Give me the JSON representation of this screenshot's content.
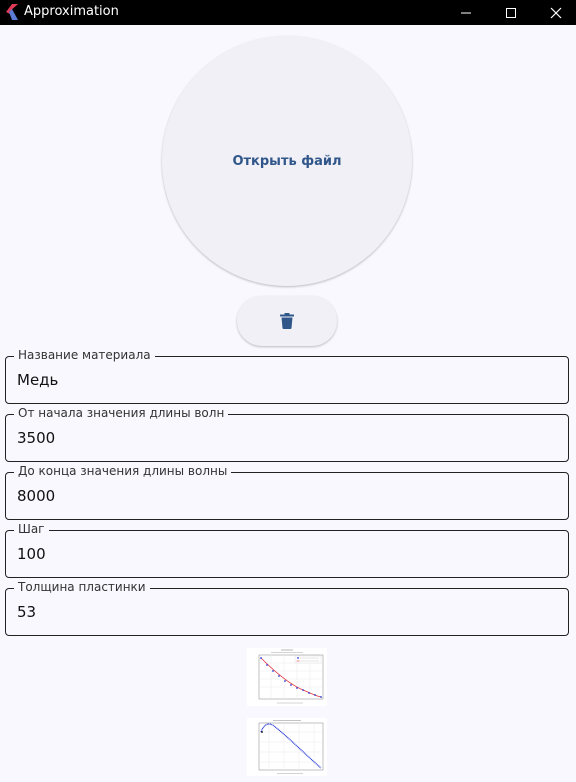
{
  "window": {
    "title": "Approximation"
  },
  "actions": {
    "open_file_label": "Открыть файл",
    "delete_icon": "trash-icon"
  },
  "fields": [
    {
      "label": "Название материала",
      "value": "Медь"
    },
    {
      "label": "От начала значения длины волн",
      "value": "3500"
    },
    {
      "label": "До конца значения длины волны",
      "value": "8000"
    },
    {
      "label": "Шаг",
      "value": "100"
    },
    {
      "label": "Толщина пластинки",
      "value": "53"
    }
  ],
  "plots": [
    {
      "icon": "approximation-plot-thumbnail"
    },
    {
      "icon": "spectrum-plot-thumbnail"
    }
  ],
  "colors": {
    "accent": "#30568a",
    "titlebar": "#000000",
    "background": "#f8f8fe",
    "plot_red": "#e0303a",
    "plot_blue": "#2a3cd8"
  }
}
